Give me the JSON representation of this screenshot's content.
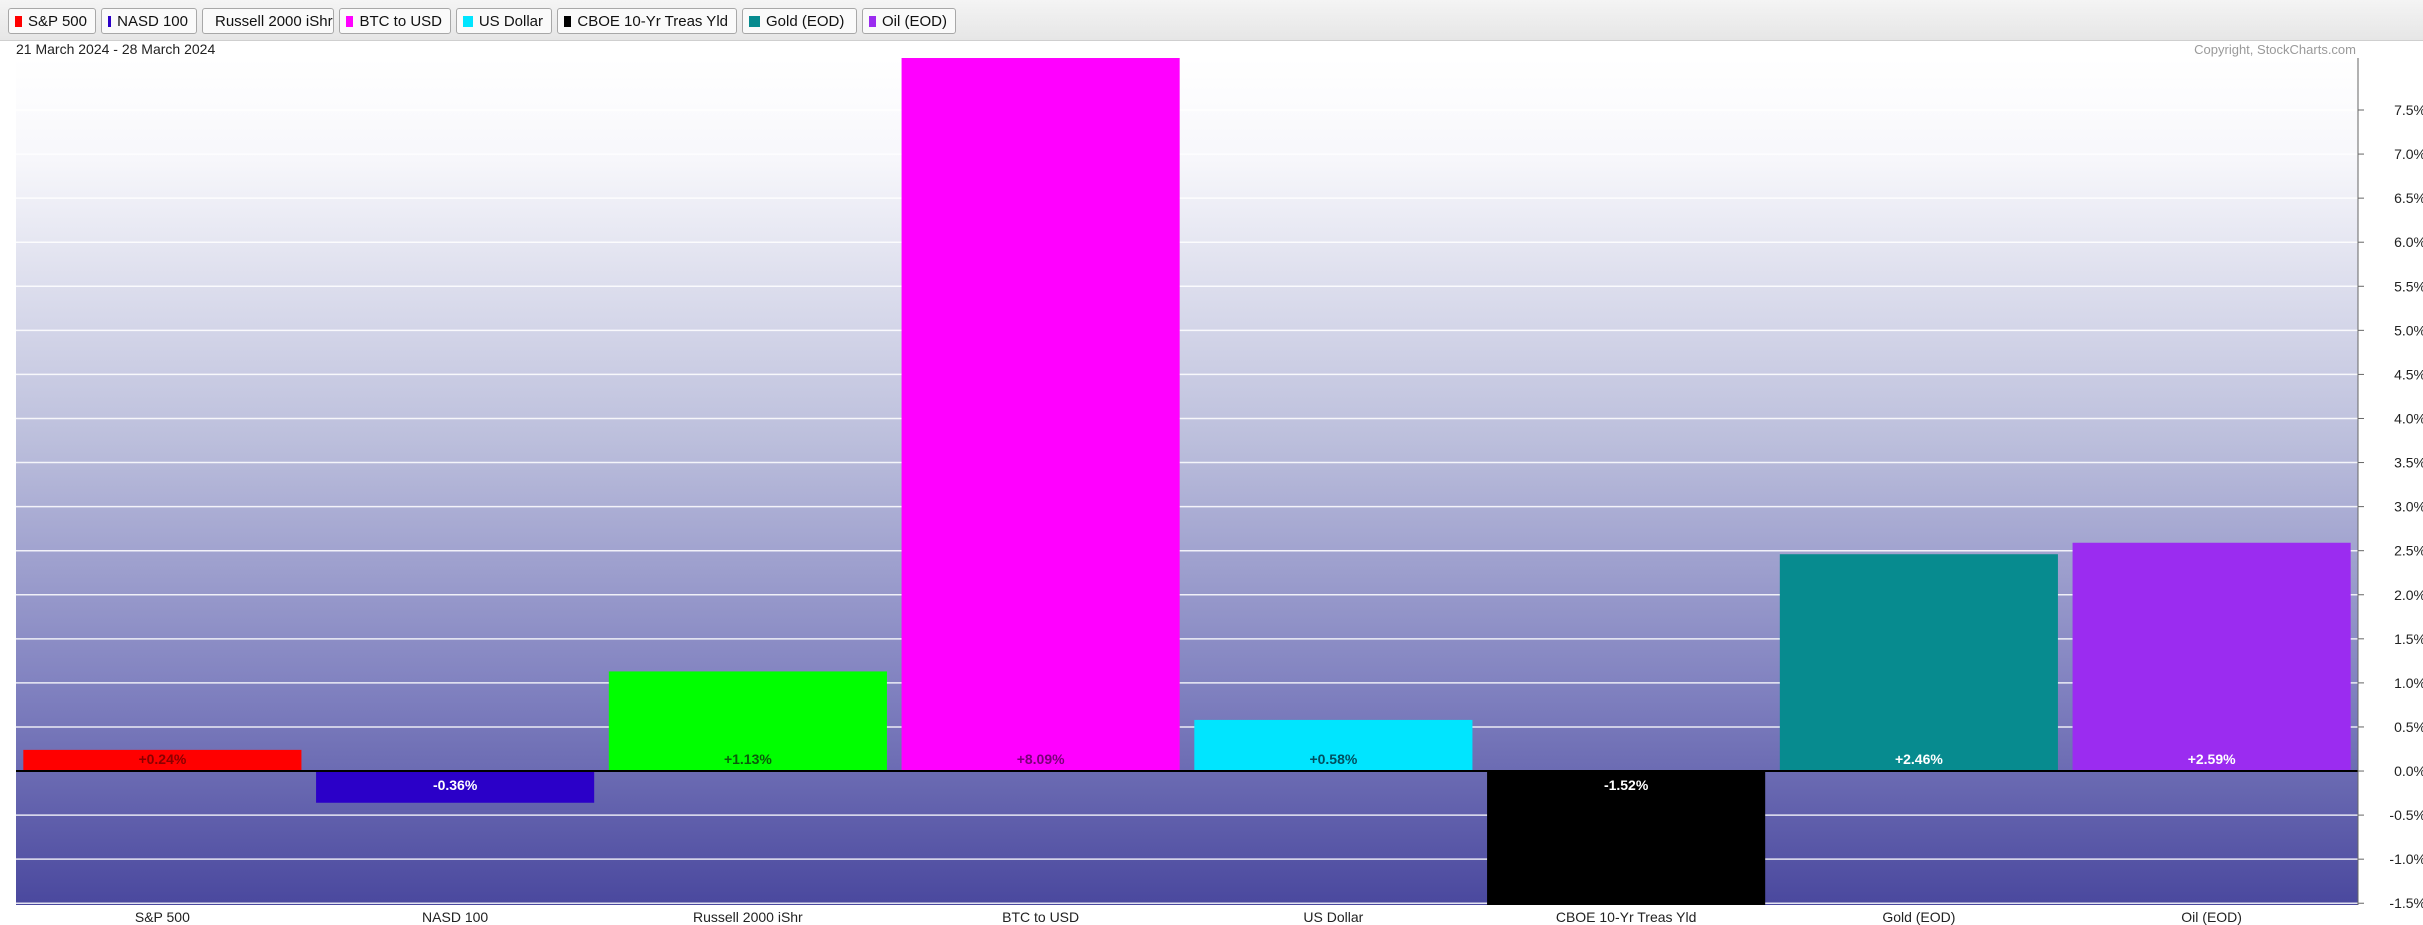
{
  "legend": [
    {
      "label": "S&P 500",
      "color": "#ff0000"
    },
    {
      "label": "NASD 100",
      "color": "#2b00c8"
    },
    {
      "label": "Russell 2000 iShr",
      "color": "#00ff00"
    },
    {
      "label": "BTC to USD",
      "color": "#ff00ff"
    },
    {
      "label": "US Dollar",
      "color": "#00e5ff"
    },
    {
      "label": "CBOE 10-Yr Treas Yld",
      "color": "#000000"
    },
    {
      "label": "Gold (EOD)",
      "color": "#078b8f"
    },
    {
      "label": "Oil (EOD)",
      "color": "#9b2cf0"
    }
  ],
  "chart_data": {
    "type": "bar",
    "date_range": "21 March 2024 - 28 March 2024",
    "copyright": "Copyright, StockCharts.com",
    "categories": [
      "S&P 500",
      "NASD 100",
      "Russell 2000 iShr",
      "BTC to USD",
      "US Dollar",
      "CBOE 10-Yr Treas Yld",
      "Gold (EOD)",
      "Oil (EOD)"
    ],
    "values": [
      0.24,
      -0.36,
      1.13,
      8.09,
      0.58,
      -1.52,
      2.46,
      2.59
    ],
    "value_labels": [
      "+0.24%",
      "-0.36%",
      "+1.13%",
      "+8.09%",
      "+0.58%",
      "-1.52%",
      "+2.46%",
      "+2.59%"
    ],
    "colors": [
      "#ff0000",
      "#2b00c8",
      "#00ff00",
      "#ff00ff",
      "#00e5ff",
      "#000000",
      "#078b8f",
      "#9b2cf0"
    ],
    "label_colors": [
      "#8b0000",
      "#ffffff",
      "#0a5a0a",
      "#7a007a",
      "#004f5f",
      "#ffffff",
      "#ffffff",
      "#ffffff"
    ],
    "ylim": [
      -1.52,
      8.09
    ],
    "yticks": [
      -1.5,
      -1.0,
      -0.5,
      0.0,
      0.5,
      1.0,
      1.5,
      2.0,
      2.5,
      3.0,
      3.5,
      4.0,
      4.5,
      5.0,
      5.5,
      6.0,
      6.5,
      7.0,
      7.5
    ],
    "ytick_labels": [
      "-1.5%",
      "-1.0%",
      "-0.5%",
      "0.0%",
      "0.5%",
      "1.0%",
      "1.5%",
      "2.0%",
      "2.5%",
      "3.0%",
      "3.5%",
      "4.0%",
      "4.5%",
      "5.0%",
      "5.5%",
      "6.0%",
      "6.5%",
      "7.0%",
      "7.5%"
    ],
    "grid": true,
    "legend_position": "top-left"
  }
}
